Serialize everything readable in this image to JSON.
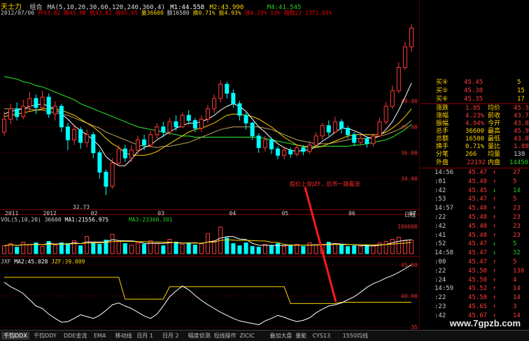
{
  "header": {
    "stock_name": "天士力",
    "mode": "组合",
    "ma_label": "MA(5,10,20,30,60,120,240,360,4)",
    "m1": "M1:44.558",
    "m2": "M2:43.990",
    "m4": "M4:41.545",
    "date_line": "2012/07/06",
    "open": "开43.82",
    "high": "高45.98",
    "low": "低43.82",
    "close": "收45.65",
    "volume": "量36600",
    "amount": "额16580",
    "turnover": "换0.71%",
    "amp": "振4.93%",
    "change": "涨4.23%",
    "limit": "13%",
    "index": "指数22 2371.01%"
  },
  "main_chart": {
    "y_ticks": [
      "40.00",
      "38.00",
      "36.00",
      "34.00"
    ],
    "x_ticks": [
      "2011",
      "2012",
      "02",
      "03",
      "04",
      "05",
      "06",
      "07"
    ],
    "low_label": "32.73",
    "annotation": "股价上穿JZF，后市一路看涨",
    "period_label": "日线",
    "candles": [
      [
        37.6,
        38.6,
        39.2,
        37.3
      ],
      [
        38.6,
        39.4,
        39.8,
        38.2
      ],
      [
        39.4,
        38.8,
        39.9,
        38.5
      ],
      [
        38.8,
        39.6,
        40.1,
        38.6
      ],
      [
        39.6,
        40.2,
        40.7,
        39.2
      ],
      [
        40.2,
        39.5,
        40.5,
        39.0
      ],
      [
        39.5,
        40.3,
        40.8,
        39.3
      ],
      [
        40.3,
        39.0,
        40.6,
        38.7
      ],
      [
        39.0,
        39.6,
        40.0,
        38.5
      ],
      [
        39.6,
        38.0,
        39.8,
        37.6
      ],
      [
        38.0,
        37.0,
        38.3,
        36.2
      ],
      [
        37.0,
        37.8,
        38.2,
        36.6
      ],
      [
        37.8,
        36.8,
        38.0,
        36.3
      ],
      [
        36.8,
        37.4,
        37.8,
        36.4
      ],
      [
        37.4,
        36.0,
        37.6,
        35.6
      ],
      [
        36.0,
        34.5,
        36.2,
        34.0
      ],
      [
        34.5,
        33.4,
        34.7,
        32.73
      ],
      [
        33.4,
        35.2,
        35.6,
        33.2
      ],
      [
        35.2,
        36.3,
        36.6,
        35.0
      ],
      [
        36.3,
        35.6,
        36.6,
        35.3
      ],
      [
        35.6,
        36.2,
        36.6,
        35.3
      ],
      [
        36.2,
        37.0,
        37.3,
        35.9
      ],
      [
        37.0,
        36.6,
        37.4,
        36.2
      ],
      [
        36.6,
        37.4,
        37.7,
        36.4
      ],
      [
        37.4,
        38.0,
        38.3,
        37.1
      ],
      [
        38.0,
        37.6,
        38.4,
        37.2
      ],
      [
        37.6,
        38.4,
        38.7,
        37.4
      ],
      [
        38.4,
        38.0,
        38.9,
        37.7
      ],
      [
        38.0,
        38.9,
        39.1,
        37.9
      ],
      [
        38.9,
        38.5,
        39.3,
        38.2
      ],
      [
        38.5,
        37.9,
        38.7,
        37.6
      ],
      [
        37.9,
        38.6,
        38.9,
        37.6
      ],
      [
        38.6,
        39.4,
        39.7,
        38.3
      ],
      [
        39.4,
        40.2,
        40.5,
        39.1
      ],
      [
        40.2,
        41.3,
        41.6,
        39.9
      ],
      [
        41.3,
        40.6,
        41.5,
        40.2
      ],
      [
        40.6,
        39.8,
        40.9,
        39.5
      ],
      [
        39.8,
        38.9,
        40.0,
        38.5
      ],
      [
        38.9,
        38.3,
        39.1,
        37.8
      ],
      [
        38.3,
        37.3,
        38.4,
        37.0
      ],
      [
        37.3,
        36.4,
        37.5,
        36.0
      ],
      [
        36.4,
        37.0,
        37.3,
        36.1
      ],
      [
        37.0,
        36.3,
        37.2,
        35.9
      ],
      [
        36.3,
        35.8,
        36.5,
        35.5
      ],
      [
        35.8,
        36.2,
        36.5,
        35.5
      ],
      [
        36.2,
        35.9,
        36.4,
        35.6
      ],
      [
        35.9,
        36.4,
        36.6,
        35.7
      ],
      [
        36.4,
        36.1,
        36.6,
        35.8
      ],
      [
        36.1,
        36.6,
        36.9,
        35.9
      ],
      [
        36.6,
        37.3,
        37.6,
        36.4
      ],
      [
        37.3,
        38.1,
        38.3,
        37.0
      ],
      [
        38.1,
        37.6,
        38.5,
        37.3
      ],
      [
        37.6,
        38.4,
        38.8,
        37.5
      ],
      [
        38.4,
        37.9,
        38.6,
        37.5
      ],
      [
        37.9,
        37.4,
        38.1,
        37.1
      ],
      [
        37.4,
        36.8,
        37.6,
        36.5
      ],
      [
        36.8,
        37.1,
        37.4,
        36.6
      ],
      [
        37.1,
        36.7,
        37.3,
        36.4
      ],
      [
        36.7,
        37.3,
        37.5,
        36.5
      ],
      [
        37.3,
        38.4,
        38.7,
        37.2
      ],
      [
        38.4,
        39.6,
        39.9,
        38.2
      ],
      [
        39.6,
        40.8,
        41.2,
        39.4
      ],
      [
        40.8,
        42.6,
        43.0,
        40.6
      ],
      [
        42.6,
        44.2,
        44.6,
        42.4
      ],
      [
        44.2,
        45.65,
        45.98,
        43.82
      ]
    ],
    "ma5": [
      39.0,
      39.2,
      39.3,
      39.4,
      39.6,
      39.7,
      39.8,
      39.6,
      39.4,
      39.0,
      38.6,
      38.1,
      37.7,
      37.4,
      37.0,
      36.5,
      35.7,
      35.3,
      35.0,
      35.0,
      35.5,
      36.1,
      36.4,
      36.6,
      37.0,
      37.3,
      37.6,
      37.9,
      38.1,
      38.3,
      38.3,
      38.4,
      38.6,
      38.9,
      39.3,
      39.6,
      39.8,
      39.6,
      39.2,
      38.6,
      38.0,
      37.6,
      37.1,
      36.7,
      36.4,
      36.2,
      36.1,
      36.2,
      36.2,
      36.5,
      36.9,
      37.2,
      37.6,
      37.9,
      37.9,
      37.7,
      37.5,
      37.2,
      37.1,
      37.3,
      37.8,
      38.4,
      39.3,
      40.3,
      41.4
    ],
    "ma10": [
      38.8,
      38.9,
      39.0,
      39.1,
      39.2,
      39.3,
      39.4,
      39.4,
      39.4,
      39.3,
      39.1,
      38.9,
      38.6,
      38.3,
      38.0,
      37.6,
      37.1,
      36.7,
      36.4,
      36.0,
      35.8,
      35.8,
      35.8,
      35.9,
      36.1,
      36.4,
      36.7,
      37.0,
      37.3,
      37.6,
      37.8,
      37.9,
      38.1,
      38.3,
      38.6,
      38.9,
      39.0,
      39.0,
      38.9,
      38.8,
      38.6,
      38.3,
      38.0,
      37.6,
      37.2,
      36.9,
      36.6,
      36.5,
      36.4,
      36.4,
      36.5,
      36.7,
      36.9,
      37.1,
      37.3,
      37.4,
      37.4,
      37.4,
      37.4,
      37.4,
      37.6,
      37.9,
      38.3,
      38.8,
      39.4
    ],
    "ma20": [
      39.4,
      39.4,
      39.4,
      39.4,
      39.4,
      39.3,
      39.3,
      39.2,
      39.1,
      39.0,
      38.9,
      38.7,
      38.5,
      38.3,
      38.1,
      37.9,
      37.6,
      37.4,
      37.2,
      37.0,
      36.8,
      36.6,
      36.5,
      36.5,
      36.4,
      36.5,
      36.5,
      36.6,
      36.7,
      36.8,
      37.0,
      37.2,
      37.4,
      37.6,
      37.8,
      37.9,
      38.0,
      38.0,
      38.0,
      38.0,
      38.0,
      37.9,
      37.8,
      37.6,
      37.4,
      37.2,
      37.0,
      36.9,
      36.8,
      36.7,
      36.7,
      36.7,
      36.8,
      36.9,
      37.0,
      37.1,
      37.1,
      37.1,
      37.2,
      37.3,
      37.4,
      37.6,
      37.8,
      38.1,
      38.5
    ],
    "ma60": [
      41.9,
      41.8,
      41.7,
      41.5,
      41.4,
      41.2,
      41.1,
      40.9,
      40.7,
      40.5,
      40.3,
      40.1,
      39.8,
      39.6,
      39.4,
      39.2,
      39.0,
      38.8,
      38.6,
      38.4,
      38.2,
      38.0,
      37.9,
      37.8,
      37.7,
      37.6,
      37.5,
      37.4,
      37.3,
      37.3,
      37.2,
      37.2,
      37.2,
      37.2,
      37.2,
      37.2,
      37.2,
      37.2,
      37.2,
      37.2,
      37.2,
      37.1,
      37.0,
      36.9,
      36.8,
      36.7,
      36.6,
      36.5,
      36.5,
      36.5,
      36.5,
      36.5,
      36.5,
      36.5,
      36.5,
      36.6,
      36.6,
      36.7,
      36.8,
      36.9,
      37.0,
      37.2,
      37.5,
      37.8,
      38.2
    ]
  },
  "volume_chart": {
    "label": "VOL(5,10,20) 36600",
    "ma1": "MA1:21556.975",
    "ma3": "MA3:23360.301",
    "y_tick": "100000",
    "values": [
      22,
      28,
      18,
      32,
      26,
      30,
      20,
      34,
      24,
      30,
      28,
      36,
      22,
      48,
      30,
      26,
      38,
      54,
      34,
      28,
      24,
      30,
      26,
      36,
      28,
      22,
      40,
      32,
      26,
      30,
      24,
      28,
      56,
      36,
      74,
      44,
      28,
      22,
      30,
      20,
      18,
      26,
      22,
      28,
      20,
      24,
      26,
      20,
      30,
      24,
      26,
      32,
      28,
      24,
      20,
      22,
      20,
      24,
      22,
      30,
      34,
      40,
      46,
      36,
      38
    ]
  },
  "indicator_chart": {
    "label": "JXF",
    "ma2": "MA2:45.028",
    "jzf": "JZF:39.009",
    "y_ticks": [
      "45.00",
      "40.00",
      "35"
    ],
    "white_line": [
      42.2,
      41.5,
      41.0,
      40.4,
      39.4,
      38.4,
      38.0,
      37.1,
      36.4,
      35.8,
      35.9,
      36.4,
      37.0,
      36.7,
      36.4,
      36.9,
      37.7,
      38.6,
      38.9,
      38.4,
      38.0,
      37.4,
      36.8,
      36.4,
      37.1,
      38.4,
      39.9,
      40.8,
      41.6,
      41.0,
      40.1,
      39.3,
      38.6,
      38.0,
      37.4,
      36.9,
      36.4,
      36.0,
      35.8,
      35.6,
      35.4,
      36.0,
      36.4,
      36.9,
      36.6,
      36.2,
      35.9,
      36.1,
      36.5,
      37.3,
      37.9,
      38.4,
      38.6,
      38.9,
      39.4,
      39.9,
      40.6,
      41.4,
      42.0,
      42.4,
      42.9,
      43.3,
      43.8,
      44.4,
      45.028
    ],
    "yellow_line": [
      43.0,
      43.0,
      43.0,
      43.0,
      43.0,
      43.0,
      43.0,
      43.0,
      43.0,
      43.0,
      43.0,
      43.0,
      43.0,
      43.0,
      43.0,
      43.0,
      43.0,
      43.0,
      43.0,
      39.5,
      39.5,
      39.5,
      39.5,
      39.5,
      39.5,
      39.5,
      41.5,
      41.5,
      41.5,
      41.5,
      41.5,
      41.5,
      41.5,
      41.5,
      41.5,
      41.5,
      41.5,
      41.5,
      41.5,
      41.5,
      41.5,
      41.5,
      41.5,
      41.5,
      41.5,
      38.8,
      38.8,
      38.8,
      38.8,
      38.8,
      38.8,
      38.8,
      38.8,
      39.009,
      39.009,
      39.009,
      39.009,
      39.009,
      39.009,
      39.009,
      39.009,
      39.009,
      39.009,
      39.009,
      39.009
    ]
  },
  "quote_panel": {
    "asks": [
      {
        "label": "买④",
        "price": "45.45",
        "qty": "5"
      },
      {
        "label": "买⑤",
        "price": "45.38",
        "qty": "15"
      },
      {
        "label": "买⑥",
        "price": "45.35",
        "qty": "17"
      }
    ],
    "stats": [
      {
        "l1": "涨跌",
        "v1": "1.85",
        "l2": "均价",
        "v2": "45.30"
      },
      {
        "l1": "涨幅",
        "v1": "4.23%",
        "l2": "前收",
        "v2": "43.75"
      },
      {
        "l1": "振幅",
        "v1": "4.94%",
        "l2": "今开",
        "v2": "43.82"
      },
      {
        "l1": "总手",
        "v1": "36600",
        "l2": "最高",
        "v2": "45.98"
      },
      {
        "l1": "总额",
        "v1": "16580",
        "l2": "最低",
        "v2": "43.82"
      },
      {
        "l1": "换手",
        "v1": "0.71%",
        "l2": "量比",
        "v2": "1.88"
      },
      {
        "l1": "分笔",
        "v1": "266",
        "l2": "均量",
        "v2": "138"
      }
    ],
    "outer": {
      "label": "外盘",
      "value": "22192",
      "inner_label": "内盘",
      "inner_value": "14450"
    },
    "ticks": [
      {
        "t": "14:56",
        "p": "45.47",
        "q": "27",
        "dir": "up"
      },
      {
        "t": ":01",
        "p": "45.48",
        "q": "5",
        "dir": "up"
      },
      {
        "t": ":42",
        "p": "45.45",
        "q": "14",
        "dir": "down"
      },
      {
        "t": ":53",
        "p": "45.47",
        "q": "5",
        "dir": "up"
      },
      {
        "t": "14:57",
        "p": "45.48",
        "q": "23",
        "dir": "up"
      },
      {
        "t": ":22",
        "p": "45.48",
        "q": "23",
        "dir": "up"
      },
      {
        "t": ":42",
        "p": "45.48",
        "q": "23",
        "dir": "up"
      },
      {
        "t": ":41",
        "p": "45.48",
        "q": "23",
        "dir": "up"
      },
      {
        "t": ":52",
        "p": "45.47",
        "q": "5",
        "dir": "down"
      },
      {
        "t": "14:58",
        "p": "45.47",
        "q": "32",
        "dir": "down"
      },
      {
        "t": ":00",
        "p": "45.47",
        "q": "5",
        "dir": "up"
      },
      {
        "t": ":22",
        "p": "45.50",
        "q": "130",
        "dir": "up"
      },
      {
        "t": ":24",
        "p": "45.50",
        "q": "4",
        "dir": "up"
      },
      {
        "t": "14:59",
        "p": "45.52",
        "q": "14",
        "dir": "up"
      },
      {
        "t": ":22",
        "p": "45.58",
        "q": "14",
        "dir": "up"
      },
      {
        "t": ":23",
        "p": "45.65",
        "q": "3",
        "dir": "up"
      },
      {
        "t": ":42",
        "p": "45.67",
        "q": "14",
        "dir": "up"
      }
    ]
  },
  "tabs": [
    "千钧DDX",
    "千钧DDY",
    "DDE金流",
    "EMA",
    "移动线",
    "日月 1",
    "日月 2",
    "幅度侦测",
    "短线操作",
    "ZICIC",
    "叠加大盘",
    "量能",
    "CYS13",
    "1550均线"
  ],
  "watermark": "www.7gpzb.com"
}
